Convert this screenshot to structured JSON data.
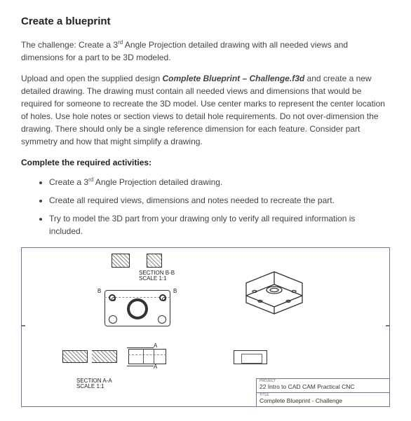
{
  "heading": "Create a blueprint",
  "intro": {
    "prefix": "The challenge: Create a 3",
    "sup": "rd",
    "rest": " Angle Projection detailed drawing with all needed views and dimensions for a part to be 3D modeled."
  },
  "para2": {
    "p1": "Upload and open the supplied design ",
    "file": "Complete Blueprint – Challenge.f3d",
    "p2": " and create a new detailed drawing.  The drawing must contain all needed views and dimensions that would be required for someone to recreate the 3D model.  Use center marks to represent the center location of holes.  Use hole notes or section views to detail hole requirements.  Do not over-dimension the drawing.  There should only be a single reference dimension for each feature.  Consider part symmetry and how that might simplify a drawing."
  },
  "activities_label": "Complete the required activities:",
  "activities": [
    {
      "pre": "Create a 3",
      "sup": "rd",
      "post": " Angle Projection detailed drawing."
    },
    {
      "pre": "Create all required views, dimensions and notes needed to recreate the part.",
      "sup": "",
      "post": ""
    },
    {
      "pre": "Try to model the 3D part from your drawing only to verify all required information is included.",
      "sup": "",
      "post": ""
    }
  ],
  "drawing": {
    "section_bb_line1": "SECTION B-B",
    "section_bb_line2": "SCALE 1:1",
    "section_aa_line1": "SECTION A-A",
    "section_aa_line2": "SCALE 1:1",
    "b_left": "B",
    "b_right": "B",
    "a1": "A",
    "a2": "A",
    "title_block": {
      "tiny1": "PROJECT",
      "line1": "22 Intro to CAD CAM Practical CNC",
      "tiny2": "TITLE",
      "line2": "Complete Blueprint - Challenge"
    }
  }
}
